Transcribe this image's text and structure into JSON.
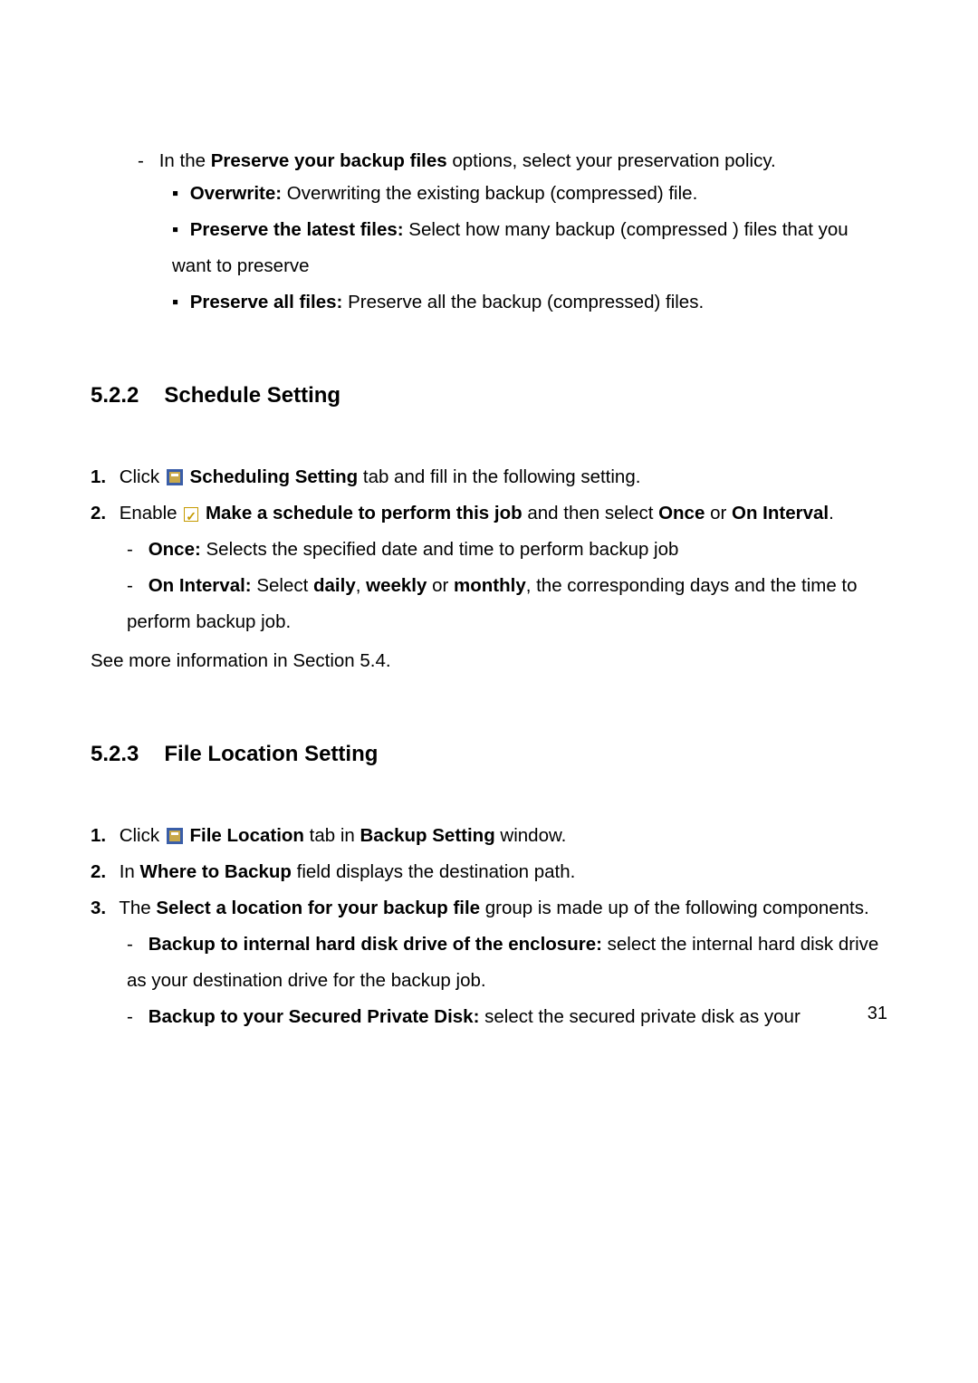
{
  "top_block": {
    "line1_pre": "In the ",
    "line1_bold": "Preserve your backup files",
    "line1_post": " options, select your preservation policy.",
    "b1_bold": "Overwrite:",
    "b1_post": " Overwriting the existing backup (compressed) file.",
    "b2_bold": "Preserve the latest files:",
    "b2_post": " Select how many backup (compressed ) files that you want to preserve",
    "b3_bold": "Preserve all files:",
    "b3_post": " Preserve all the backup (compressed) files."
  },
  "sec522": {
    "num": "5.2.2",
    "title": "Schedule Setting",
    "step1_pre": "Click ",
    "step1_bold": " Scheduling Setting",
    "step1_post": " tab and fill in the following setting.",
    "step2_pre": "Enable ",
    "step2_bold": " Make a schedule to perform this job",
    "step2_mid": " and then select ",
    "step2_once": "Once",
    "step2_or": " or ",
    "step2_interval": "On Interval",
    "step2_end": ".",
    "sub1_bold": "Once:",
    "sub1_post": " Selects the specified date and time to perform backup job",
    "sub2_bold": "On Interval:",
    "sub2_mid1": " Select ",
    "sub2_daily": "daily",
    "sub2_c1": ", ",
    "sub2_weekly": "weekly",
    "sub2_or": " or ",
    "sub2_monthly": "monthly",
    "sub2_post": ", the corresponding days and the time to perform backup job.",
    "seemore": "See more information in Section 5.4."
  },
  "sec523": {
    "num": "5.2.3",
    "title": "File Location Setting",
    "s1_pre": " Click ",
    "s1_bold": " File Location",
    "s1_mid": " tab in ",
    "s1_bold2": "Backup Setting",
    "s1_post": " window.",
    "s2_pre": " In ",
    "s2_bold": "Where to Backup",
    "s2_post": " field displays the destination path.",
    "s3_pre": " The ",
    "s3_bold": "Select a location for your backup file",
    "s3_post": " group is made up of the following components.",
    "sub1_bold": "Backup to internal hard disk drive of the enclosure:",
    "sub1_post": " select the internal hard disk drive as your destination drive for the backup job.",
    "sub2_bold": "Backup to your Secured Private Disk:",
    "sub2_post": " select the secured private disk as your"
  },
  "page_number": "31",
  "labels": {
    "n1": "1.",
    "n2": "2.",
    "n3": "3."
  }
}
